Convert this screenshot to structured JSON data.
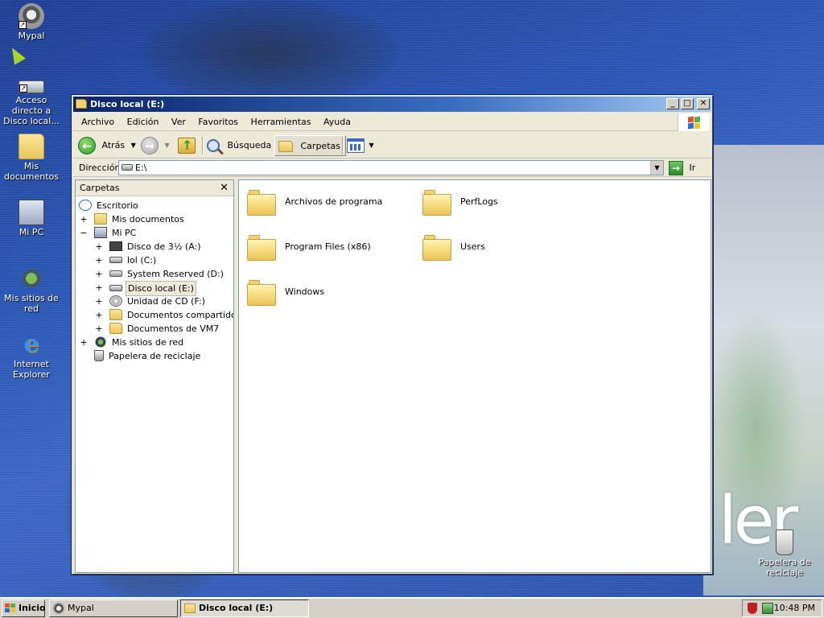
{
  "desktop": {
    "icons": [
      {
        "label": "Mypal",
        "icon": "raccoon-icon"
      },
      {
        "label": "Acceso directo a Disco local...",
        "icon": "drive-shortcut-icon"
      },
      {
        "label": "Mis documentos",
        "icon": "folder-icon"
      },
      {
        "label": "Mi PC",
        "icon": "computer-icon"
      },
      {
        "label": "Mis sitios de red",
        "icon": "network-icon"
      },
      {
        "label": "Internet Explorer",
        "icon": "ie-icon"
      },
      {
        "label": "Papelera de reciclaje",
        "icon": "recycle-bin-icon"
      }
    ],
    "wallpaper_text": "ler"
  },
  "window": {
    "title": "Disco local (E:)",
    "menu": [
      "Archivo",
      "Edición",
      "Ver",
      "Favoritos",
      "Herramientas",
      "Ayuda"
    ],
    "toolbar": {
      "back_label": "Atrás",
      "search_label": "Búsqueda",
      "folders_label": "Carpetas"
    },
    "address": {
      "label": "Dirección",
      "value": "E:\\",
      "go_label": "Ir"
    },
    "folders_pane": {
      "title": "Carpetas",
      "close_glyph": "✕",
      "tree": [
        {
          "label": "Escritorio",
          "icon": "desktop-icon",
          "level": 0,
          "expander": ""
        },
        {
          "label": "Mis documentos",
          "icon": "documents-icon",
          "level": 1,
          "expander": "+"
        },
        {
          "label": "Mi PC",
          "icon": "computer-icon",
          "level": 1,
          "expander": "−"
        },
        {
          "label": "Disco de 3½ (A:)",
          "icon": "floppy-icon",
          "level": 2,
          "expander": "+"
        },
        {
          "label": "lol (C:)",
          "icon": "drive-icon",
          "level": 2,
          "expander": "+"
        },
        {
          "label": "System Reserved (D:)",
          "icon": "drive-icon",
          "level": 2,
          "expander": "+"
        },
        {
          "label": "Disco local (E:)",
          "icon": "drive-icon",
          "level": 2,
          "expander": "+",
          "selected": true
        },
        {
          "label": "Unidad de CD (F:)",
          "icon": "cd-icon",
          "level": 2,
          "expander": "+"
        },
        {
          "label": "Documentos compartidos",
          "icon": "folder-icon",
          "level": 2,
          "expander": "+"
        },
        {
          "label": "Documentos de VM7",
          "icon": "folder-icon",
          "level": 2,
          "expander": "+"
        },
        {
          "label": "Mis sitios de red",
          "icon": "network-icon",
          "level": 1,
          "expander": "+"
        },
        {
          "label": "Papelera de reciclaje",
          "icon": "recycle-bin-icon",
          "level": 1,
          "expander": ""
        }
      ]
    },
    "items": [
      {
        "name": "Archivos de programa",
        "icon": "folder-icon"
      },
      {
        "name": "PerfLogs",
        "icon": "folder-icon"
      },
      {
        "name": "Program Files (x86)",
        "icon": "folder-icon"
      },
      {
        "name": "Users",
        "icon": "folder-icon"
      },
      {
        "name": "Windows",
        "icon": "folder-icon"
      }
    ]
  },
  "taskbar": {
    "start_label": "Inicio",
    "tasks": [
      {
        "label": "Mypal",
        "active": false
      },
      {
        "label": "Disco local (E:)",
        "active": true
      }
    ],
    "clock": "10:48 PM"
  },
  "colors": {
    "title_active": "#0a246a",
    "title_gradient_end": "#a6caf0",
    "desktop_blue": "#2b58b5",
    "chrome": "#ece9d8"
  }
}
